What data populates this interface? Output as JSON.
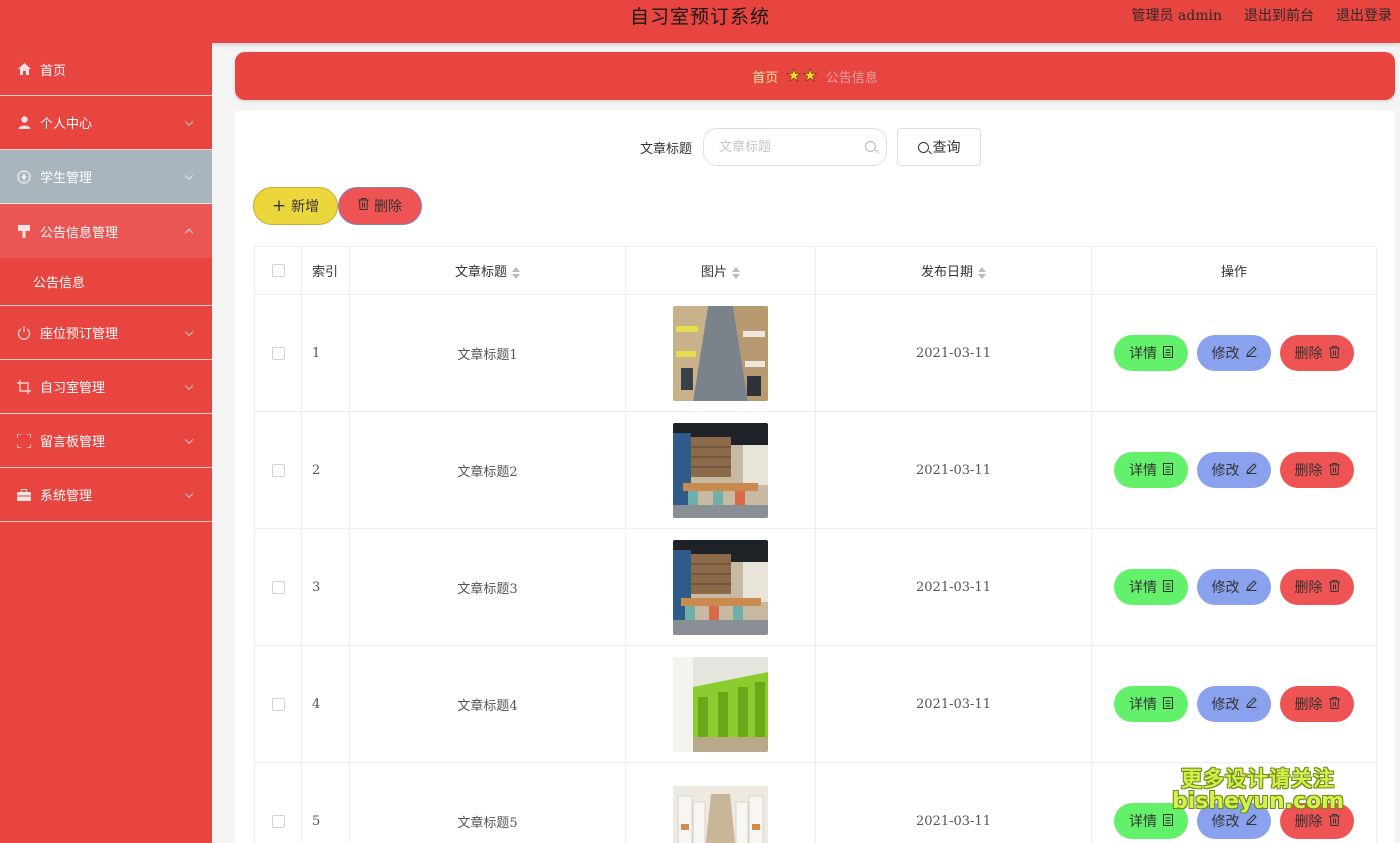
{
  "header": {
    "title": "自习室预订系统",
    "admin_label": "管理员 admin",
    "front_link": "退出到前台",
    "logout_link": "退出登录"
  },
  "sidebar": {
    "items": [
      {
        "label": "首页",
        "icon": "home-icon"
      },
      {
        "label": "个人中心",
        "icon": "user-icon"
      },
      {
        "label": "学生管理",
        "icon": "compass-icon"
      },
      {
        "label": "公告信息管理",
        "icon": "brush-icon"
      },
      {
        "label": "座位预订管理",
        "icon": "power-icon"
      },
      {
        "label": "自习室管理",
        "icon": "crop-icon"
      },
      {
        "label": "留言板管理",
        "icon": "frame-icon"
      },
      {
        "label": "系统管理",
        "icon": "briefcase-icon"
      }
    ],
    "submenu": {
      "label": "公告信息"
    }
  },
  "breadcrumb": {
    "home": "首页",
    "current": "公告信息"
  },
  "search": {
    "label": "文章标题",
    "placeholder": "文章标题",
    "button": "查询"
  },
  "actions": {
    "add": "新增",
    "delete": "删除"
  },
  "table": {
    "columns": {
      "index": "索引",
      "title": "文章标题",
      "image": "图片",
      "date": "发布日期",
      "ops": "操作"
    },
    "rows": [
      {
        "index": "1",
        "title": "文章标题1",
        "date": "2021-03-11"
      },
      {
        "index": "2",
        "title": "文章标题2",
        "date": "2021-03-11"
      },
      {
        "index": "3",
        "title": "文章标题3",
        "date": "2021-03-11"
      },
      {
        "index": "4",
        "title": "文章标题4",
        "date": "2021-03-11"
      },
      {
        "index": "5",
        "title": "文章标题5",
        "date": "2021-03-11"
      }
    ],
    "row_actions": {
      "detail": "详情",
      "edit": "修改",
      "remove": "删除"
    }
  },
  "watermark": {
    "line1": "更多设计请关注",
    "line2": "bisheyun.com"
  },
  "colors": {
    "primary": "#e84440",
    "detail": "#63f06b",
    "edit": "#8aa2ee",
    "danger": "#ef5455",
    "add": "#ebd63c"
  }
}
